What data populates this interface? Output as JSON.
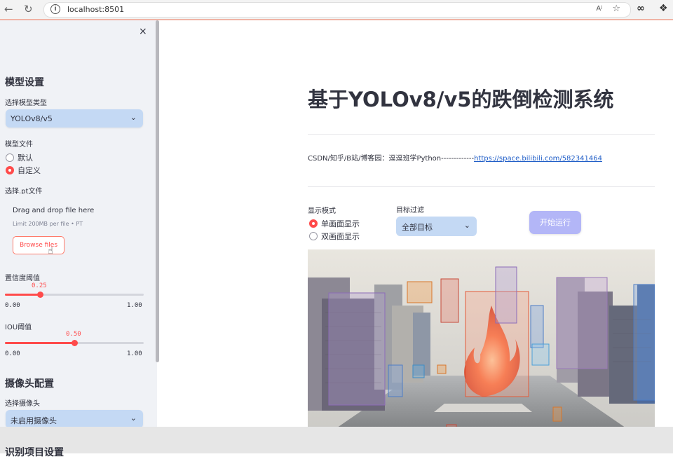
{
  "browser": {
    "url": "localhost:8501",
    "back_icon": "arrow-left-icon",
    "reload_icon": "reload-icon",
    "info_icon": "info-icon",
    "read_aloud_label": "Aʲ",
    "icons": [
      "star-icon",
      "infinity-icon",
      "puzzle-icon"
    ]
  },
  "sidebar": {
    "close_label": "×",
    "model_section_title": "模型设置",
    "model_type_label": "选择模型类型",
    "model_type_value": "YOLOv8/v5",
    "model_file_label": "模型文件",
    "model_file_options": [
      "默认",
      "自定义"
    ],
    "model_file_selected": 1,
    "pt_file_label": "选择.pt文件",
    "dropzone_title": "Drag and drop file here",
    "dropzone_limit": "Limit 200MB per file • PT",
    "browse_label": "Browse files",
    "conf_label": "置信度阈值",
    "conf_value": "0.25",
    "conf_fraction": 0.25,
    "iou_label": "IOU阈值",
    "iou_value": "0.50",
    "iou_fraction": 0.5,
    "slider_min": "0.00",
    "slider_max": "1.00",
    "camera_section_title": "摄像头配置",
    "camera_label": "选择摄像头",
    "camera_value": "未启用摄像头",
    "recog_section_title": "识别项目设置"
  },
  "main": {
    "title": "基于YOLOv8/v5的跌倒检测系统",
    "credit_prefix": "CSDN/知乎/B站/博客园：逗逗班学Python-------------",
    "credit_link": "https://space.bilibili.com/582341464",
    "display_mode_label": "显示模式",
    "display_options": [
      "单画面显示",
      "双画面显示"
    ],
    "display_selected": 0,
    "filter_label": "目标过滤",
    "filter_value": "全部目标",
    "run_button": "开始运行"
  },
  "colors": {
    "accent": "#ff4b4b",
    "select_bg": "#c4d9f4",
    "run_button_bg": "#b3b6f7",
    "sidebar_bg": "#f0f2f6",
    "link": "#1f5dc7"
  }
}
